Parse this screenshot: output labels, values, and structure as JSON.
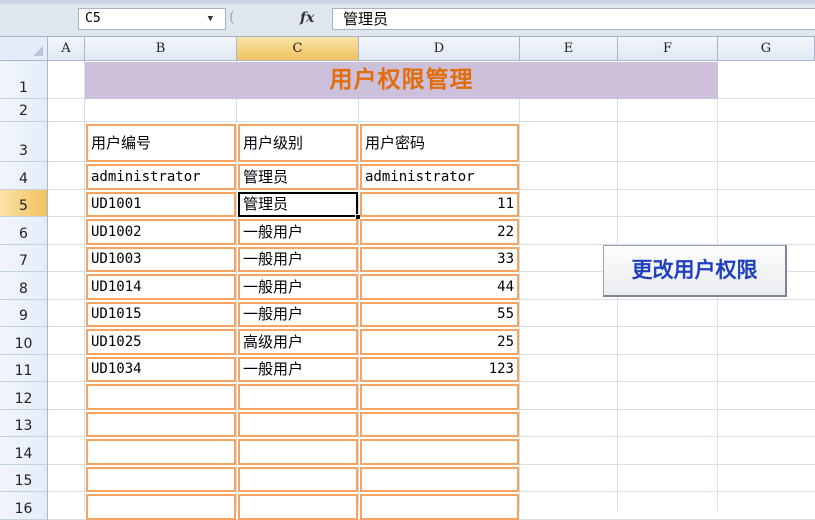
{
  "formula_bar": {
    "name_box": "C5",
    "formula": "管理员",
    "fx_label": "fx",
    "dropdown_icon": "chevron-down-icon"
  },
  "columns": [
    "A",
    "B",
    "C",
    "D",
    "E",
    "F",
    "G"
  ],
  "active_column": "C",
  "rows": [
    "1",
    "2",
    "3",
    "4",
    "5",
    "6",
    "7",
    "8",
    "9",
    "10",
    "11",
    "12",
    "13",
    "14",
    "15",
    "16"
  ],
  "active_row": "5",
  "title": "用户权限管理",
  "table": {
    "headers": [
      "用户编号",
      "用户级别",
      "用户密码"
    ],
    "rows": [
      [
        "administrator",
        "管理员",
        "administrator"
      ],
      [
        "UD1001",
        "管理员",
        "11"
      ],
      [
        "UD1002",
        "一般用户",
        "22"
      ],
      [
        "UD1003",
        "一般用户",
        "33"
      ],
      [
        "UD1014",
        "一般用户",
        "44"
      ],
      [
        "UD1015",
        "一般用户",
        "55"
      ],
      [
        "UD1025",
        "高级用户",
        "25"
      ],
      [
        "UD1034",
        "一般用户",
        "123"
      ],
      [
        "",
        "",
        ""
      ],
      [
        "",
        "",
        ""
      ],
      [
        "",
        "",
        ""
      ],
      [
        "",
        "",
        ""
      ],
      [
        "",
        "",
        ""
      ]
    ]
  },
  "button": {
    "label": "更改用户权限"
  },
  "colors": {
    "title_text": "#e36c0a",
    "title_fill": "#ccc0da",
    "table_border": "#f4a460",
    "button_text": "#1f3fbf"
  }
}
